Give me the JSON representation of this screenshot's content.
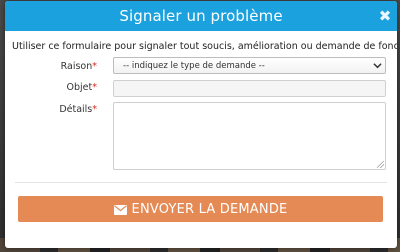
{
  "modal": {
    "title": "Signaler un problème",
    "close_glyph": "✖",
    "intro": "Utiliser ce formulaire pour signaler tout soucis, amélioration ou demande de fonctionnalité."
  },
  "form": {
    "raison_label": "Raison",
    "objet_label": "Objet",
    "details_label": "Détails",
    "required_mark": "*",
    "raison_selected": "-- indiquez le type de demande --",
    "objet_value": "",
    "details_value": ""
  },
  "submit": {
    "label": "ENVOYER LA DEMANDE",
    "icon": "envelope-icon"
  },
  "colors": {
    "header": "#1ba1de",
    "submit": "#e58a55",
    "required": "#d52b1e"
  }
}
